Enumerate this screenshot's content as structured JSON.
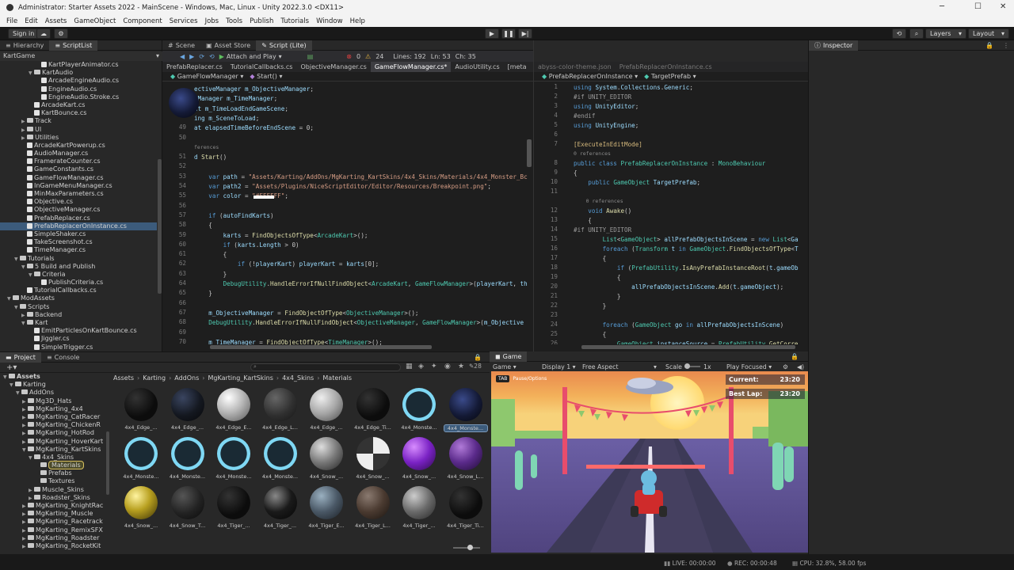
{
  "window": {
    "title": "Administrator: Starter Assets 2022 - MainScene - Windows, Mac, Linux - Unity 2022.3.0 <DX11>"
  },
  "menu": [
    "File",
    "Edit",
    "Assets",
    "GameObject",
    "Component",
    "Services",
    "Jobs",
    "Tools",
    "Publish",
    "Tutorials",
    "Window",
    "Help"
  ],
  "toolbar": {
    "sign_in": "Sign in",
    "layers": "Layers",
    "layout": "Layout"
  },
  "hierarchy": {
    "tabs": [
      "Hierarchy",
      "ScriptList"
    ],
    "header": "KartGame",
    "items": [
      {
        "t": "KartPlayerAnimator.cs",
        "d": 5,
        "k": "f"
      },
      {
        "t": "KartAudio",
        "d": 4,
        "k": "o"
      },
      {
        "t": "ArcadeEngineAudio.cs",
        "d": 5,
        "k": "f"
      },
      {
        "t": "EngineAudio.cs",
        "d": 5,
        "k": "f"
      },
      {
        "t": "EngineAudio.Stroke.cs",
        "d": 5,
        "k": "f"
      },
      {
        "t": "ArcadeKart.cs",
        "d": 4,
        "k": "f"
      },
      {
        "t": "KartBounce.cs",
        "d": 4,
        "k": "f"
      },
      {
        "t": "Track",
        "d": 3,
        "k": "c"
      },
      {
        "t": "UI",
        "d": 3,
        "k": "c"
      },
      {
        "t": "Utilities",
        "d": 3,
        "k": "c"
      },
      {
        "t": "ArcadeKartPowerup.cs",
        "d": 3,
        "k": "f"
      },
      {
        "t": "AudioManager.cs",
        "d": 3,
        "k": "f"
      },
      {
        "t": "FramerateCounter.cs",
        "d": 3,
        "k": "f"
      },
      {
        "t": "GameConstants.cs",
        "d": 3,
        "k": "f"
      },
      {
        "t": "GameFlowManager.cs",
        "d": 3,
        "k": "f"
      },
      {
        "t": "InGameMenuManager.cs",
        "d": 3,
        "k": "f"
      },
      {
        "t": "MinMaxParameters.cs",
        "d": 3,
        "k": "f"
      },
      {
        "t": "Objective.cs",
        "d": 3,
        "k": "f"
      },
      {
        "t": "ObjectiveManager.cs",
        "d": 3,
        "k": "f"
      },
      {
        "t": "PrefabReplacer.cs",
        "d": 3,
        "k": "f"
      },
      {
        "t": "PrefabReplacerOnInstance.cs",
        "d": 3,
        "k": "f",
        "sel": true
      },
      {
        "t": "SimpleShaker.cs",
        "d": 3,
        "k": "f"
      },
      {
        "t": "TakeScreenshot.cs",
        "d": 3,
        "k": "f"
      },
      {
        "t": "TimeManager.cs",
        "d": 3,
        "k": "f"
      },
      {
        "t": "Tutorials",
        "d": 2,
        "k": "o"
      },
      {
        "t": "5 Build and Publish",
        "d": 3,
        "k": "o"
      },
      {
        "t": "Criteria",
        "d": 4,
        "k": "o"
      },
      {
        "t": "PublishCriteria.cs",
        "d": 5,
        "k": "f"
      },
      {
        "t": "TutorialCallbacks.cs",
        "d": 3,
        "k": "f"
      },
      {
        "t": "ModAssets",
        "d": 1,
        "k": "o"
      },
      {
        "t": "Scripts",
        "d": 2,
        "k": "o"
      },
      {
        "t": "Backend",
        "d": 3,
        "k": "c"
      },
      {
        "t": "Kart",
        "d": 3,
        "k": "o"
      },
      {
        "t": "EmitParticlesOnKartBounce.cs",
        "d": 4,
        "k": "f"
      },
      {
        "t": "Jiggler.cs",
        "d": 4,
        "k": "f"
      },
      {
        "t": "SimpleTrigger.cs",
        "d": 4,
        "k": "f"
      }
    ]
  },
  "editor_left": {
    "scene_tabs": [
      "Scene",
      "Asset Store",
      "Script (Lite)"
    ],
    "attach": "Attach and Play",
    "errors": "0",
    "warnings": "24",
    "lines": "Lines: 192",
    "ln": "Ln: 53",
    "ch": "Ch: 35",
    "doc_tabs": [
      "PrefabReplacer.cs",
      "TutorialCallbacks.cs",
      "ObjectiveManager.cs",
      "GameFlowManager.cs*",
      "AudioUtility.cs",
      "[meta"
    ],
    "nav": [
      "GameFlowManager",
      "Start()"
    ],
    "lines_code": [
      {
        "n": "",
        "c": "ectiveManager m_ObjectiveManager;"
      },
      {
        "n": "",
        "c": "eManager m_TimeManager;"
      },
      {
        "n": "",
        "c": "at m_TimeLoadEndGameScene;"
      },
      {
        "n": "",
        "c": "ing m_SceneToLoad;"
      },
      {
        "n": "49",
        "c": "at elapsedTimeBeforeEndScene = 0;"
      },
      {
        "n": "50",
        "c": ""
      },
      {
        "n": "",
        "c": "ferences",
        "ref": true
      },
      {
        "n": "51",
        "c": "d Start()"
      },
      {
        "n": "52",
        "c": ""
      },
      {
        "n": "53",
        "c": "    var path = \"Assets/Karting/AddOns/MgKarting_KartSkins/4x4_Skins/Materials/4x4_Monster_Bc"
      },
      {
        "n": "54",
        "c": "    var path2 = \"Assets/Plugins/NiceScriptEditor/Editor/Resources/Breakpoint.png\";"
      },
      {
        "n": "55",
        "c": "    var color = \"#FFFFFF\";"
      },
      {
        "n": "56",
        "c": ""
      },
      {
        "n": "57",
        "c": "    if (autoFindKarts)"
      },
      {
        "n": "58",
        "c": "    {"
      },
      {
        "n": "59",
        "c": "        karts = FindObjectsOfType<ArcadeKart>();"
      },
      {
        "n": "60",
        "c": "        if (karts.Length > 0)"
      },
      {
        "n": "61",
        "c": "        {"
      },
      {
        "n": "62",
        "c": "            if (!playerKart) playerKart = karts[0];"
      },
      {
        "n": "63",
        "c": "        }"
      },
      {
        "n": "64",
        "c": "        DebugUtility.HandleErrorIfNullFindObject<ArcadeKart, GameFlowManager>(playerKart, th"
      },
      {
        "n": "65",
        "c": "    }"
      },
      {
        "n": "66",
        "c": ""
      },
      {
        "n": "67",
        "c": "    m_ObjectiveManager = FindObjectOfType<ObjectiveManager>();"
      },
      {
        "n": "68",
        "c": "    DebugUtility.HandleErrorIfNullFindObject<ObjectiveManager, GameFlowManager>(m_Objective"
      },
      {
        "n": "69",
        "c": ""
      },
      {
        "n": "70",
        "c": "    m_TimeManager = FindObjectOfType<TimeManager>();"
      },
      {
        "n": "71",
        "c": ""
      }
    ]
  },
  "editor_right": {
    "doc_tabs": [
      "abyss-color-theme.json",
      "PrefabReplacerOnInstance.cs"
    ],
    "nav": [
      "PrefabReplacerOnInstance",
      "TargetPrefab"
    ],
    "lines_code": [
      {
        "n": "1",
        "c": "using System.Collections.Generic;"
      },
      {
        "n": "2",
        "c": "#if UNITY_EDITOR"
      },
      {
        "n": "3",
        "c": "using UnityEditor;"
      },
      {
        "n": "4",
        "c": "#endif"
      },
      {
        "n": "5",
        "c": "using UnityEngine;"
      },
      {
        "n": "6",
        "c": ""
      },
      {
        "n": "7",
        "c": "[ExecuteInEditMode]"
      },
      {
        "n": "",
        "c": "0 references",
        "ref": true
      },
      {
        "n": "8",
        "c": "public class PrefabReplacerOnInstance : MonoBehaviour"
      },
      {
        "n": "9",
        "c": "{"
      },
      {
        "n": "10",
        "c": "    public GameObject TargetPrefab;"
      },
      {
        "n": "11",
        "c": ""
      },
      {
        "n": "",
        "c": "    0 references",
        "ref": true
      },
      {
        "n": "12",
        "c": "    void Awake()"
      },
      {
        "n": "13",
        "c": "    {"
      },
      {
        "n": "14",
        "c": "#if UNITY_EDITOR"
      },
      {
        "n": "15",
        "c": "        List<GameObject> allPrefabObjectsInScene = new List<Ga"
      },
      {
        "n": "16",
        "c": "        foreach (Transform t in GameObject.FindObjectsOfType<T"
      },
      {
        "n": "17",
        "c": "        {"
      },
      {
        "n": "18",
        "c": "            if (PrefabUtility.IsAnyPrefabInstanceRoot(t.gameOb"
      },
      {
        "n": "19",
        "c": "            {"
      },
      {
        "n": "20",
        "c": "                allPrefabObjectsInScene.Add(t.gameObject);"
      },
      {
        "n": "21",
        "c": "            }"
      },
      {
        "n": "22",
        "c": "        }"
      },
      {
        "n": "23",
        "c": ""
      },
      {
        "n": "24",
        "c": "        foreach (GameObject go in allPrefabObjectsInScene)"
      },
      {
        "n": "25",
        "c": "        {"
      },
      {
        "n": "26",
        "c": "            GameObject instanceSource = PrefabUtility.GetCorre"
      }
    ]
  },
  "inspector": {
    "tab": "Inspector"
  },
  "project": {
    "tabs": [
      "Project",
      "Console"
    ],
    "count": "28",
    "breadcrumb": [
      "Assets",
      "Karting",
      "AddOns",
      "MgKarting_KartSkins",
      "4x4_Skins",
      "Materials"
    ],
    "tree": [
      {
        "t": "Assets",
        "d": 0,
        "k": "o",
        "b": true
      },
      {
        "t": "Karting",
        "d": 1,
        "k": "o"
      },
      {
        "t": "AddOns",
        "d": 2,
        "k": "o"
      },
      {
        "t": "Mg3D_Hats",
        "d": 3,
        "k": "c"
      },
      {
        "t": "MgKarting_4x4",
        "d": 3,
        "k": "c"
      },
      {
        "t": "MgKarting_CatRacer",
        "d": 3,
        "k": "c"
      },
      {
        "t": "MgKarting_ChickenR",
        "d": 3,
        "k": "c"
      },
      {
        "t": "MgKarting_HotRod",
        "d": 3,
        "k": "c"
      },
      {
        "t": "MgKarting_HoverKart",
        "d": 3,
        "k": "c"
      },
      {
        "t": "MgKarting_KartSkins",
        "d": 3,
        "k": "o"
      },
      {
        "t": "4x4_Skins",
        "d": 4,
        "k": "o"
      },
      {
        "t": "Materials",
        "d": 5,
        "k": "n",
        "sel": true
      },
      {
        "t": "Prefabs",
        "d": 5,
        "k": "n"
      },
      {
        "t": "Textures",
        "d": 5,
        "k": "n"
      },
      {
        "t": "Muscle_Skins",
        "d": 4,
        "k": "c"
      },
      {
        "t": "Roadster_Skins",
        "d": 4,
        "k": "c"
      },
      {
        "t": "MgKarting_KnightRac",
        "d": 3,
        "k": "c"
      },
      {
        "t": "MgKarting_Muscle",
        "d": 3,
        "k": "c"
      },
      {
        "t": "MgKarting_Racetrack",
        "d": 3,
        "k": "c"
      },
      {
        "t": "MgKarting_RemixSFX",
        "d": 3,
        "k": "c"
      },
      {
        "t": "MgKarting_Roadster",
        "d": 3,
        "k": "c"
      },
      {
        "t": "MgKarting_RocketKit",
        "d": 3,
        "k": "c"
      }
    ],
    "materials": [
      {
        "l": "4x4_Edge_...",
        "s": "black"
      },
      {
        "l": "4x4_Edge_...",
        "s": "darkblue"
      },
      {
        "l": "4x4_Edge_E...",
        "s": "silver"
      },
      {
        "l": "4x4_Edge_L...",
        "s": "darkgrey"
      },
      {
        "l": "4x4_Edge_...",
        "s": "lightgrey"
      },
      {
        "l": "4x4_Edge_Ti...",
        "s": "black"
      },
      {
        "l": "4x4_Monste...",
        "s": "cyanring"
      },
      {
        "l": "4x4_Monste...",
        "s": "navy",
        "sel": true
      },
      {
        "l": "4x4_Monste...",
        "s": "cyanring"
      },
      {
        "l": "4x4_Monste...",
        "s": "cyanring"
      },
      {
        "l": "4x4_Monste...",
        "s": "cyanring"
      },
      {
        "l": "4x4_Monste...",
        "s": "cyanring"
      },
      {
        "l": "4x4_Snow_...",
        "s": "pattern"
      },
      {
        "l": "4x4_Snow_...",
        "s": "checker"
      },
      {
        "l": "4x4_Snow_...",
        "s": "purple"
      },
      {
        "l": "4x4_Snow_L...",
        "s": "purpledark"
      },
      {
        "l": "4x4_Snow_...",
        "s": "gold"
      },
      {
        "l": "4x4_Snow_T...",
        "s": "charcoal"
      },
      {
        "l": "4x4_Tiger_...",
        "s": "black"
      },
      {
        "l": "4x4_Tiger_...",
        "s": "blackstripe"
      },
      {
        "l": "4x4_Tiger_E...",
        "s": "steel"
      },
      {
        "l": "4x4_Tiger_L...",
        "s": "brown"
      },
      {
        "l": "4x4_Tiger_...",
        "s": "greymetal"
      },
      {
        "l": "4x4_Tiger_Ti...",
        "s": "black"
      }
    ]
  },
  "game": {
    "tab": "Game",
    "mode": "Game",
    "display": "Display 1",
    "aspect": "Free Aspect",
    "scale_label": "Scale",
    "scale_value": "1x",
    "play_focused": "Play Focused",
    "hud": {
      "tab_key": "TAB",
      "tab_hint": "Pause/Options",
      "current_label": "Current:",
      "current_time": "23:20",
      "best_label": "Best Lap:",
      "best_time": "23:20"
    }
  },
  "status": {
    "live": "LIVE: 00:00:00",
    "rec": "REC: 00:00:48",
    "cpu": "CPU: 32.8%, 58.00 fps"
  },
  "colors": {
    "accent": "#3c5b7b",
    "editor_bg": "#1e1e1e",
    "panel_bg": "#282828"
  }
}
